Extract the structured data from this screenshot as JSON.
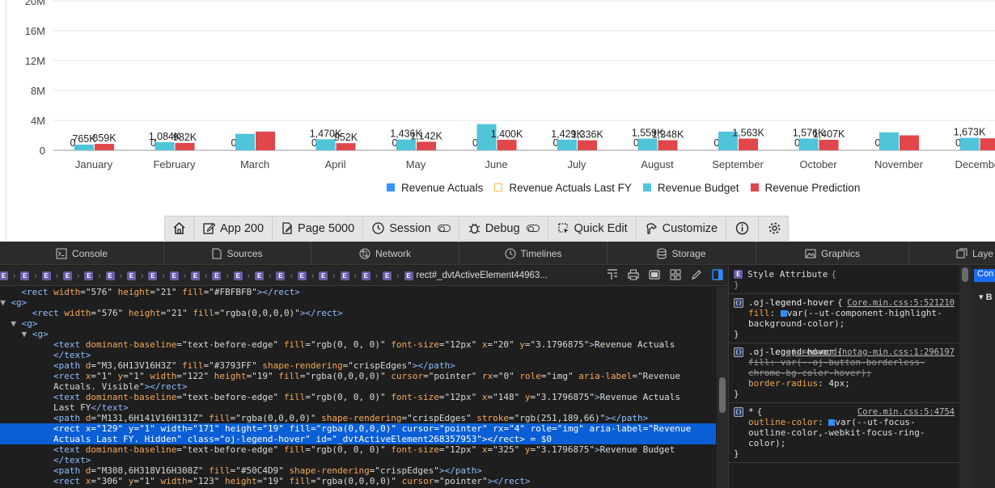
{
  "chart_data": {
    "type": "bar",
    "categories": [
      "January",
      "February",
      "March",
      "April",
      "May",
      "June",
      "July",
      "August",
      "September",
      "October",
      "November",
      "December"
    ],
    "y_ticks": [
      "0",
      "4M",
      "8M",
      "12M",
      "16M",
      "20M"
    ],
    "ylim": [
      0,
      20000000
    ],
    "grid": true,
    "legend_placement": "bottom",
    "series": [
      {
        "name": "Revenue Actuals",
        "color": "#3793FF",
        "values": [
          0,
          0,
          0,
          0,
          0,
          0,
          0,
          0,
          0,
          0,
          0,
          0
        ],
        "labels": [
          "0",
          "0",
          "0",
          "0",
          "0",
          "0",
          "0",
          "0",
          "0",
          "0",
          "0",
          "0"
        ]
      },
      {
        "name": "Revenue Actuals Last FY",
        "color": "#FBBD42",
        "hidden": true,
        "values": []
      },
      {
        "name": "Revenue Budget",
        "color": "#50C4D9",
        "values": [
          765000,
          1084000,
          2200000,
          1470000,
          1436000,
          3500000,
          1429000,
          1559000,
          2500000,
          1576000,
          2400000,
          1673000
        ],
        "labels": [
          "765K",
          "1,084K",
          "",
          "1,470K",
          "1,436K",
          "",
          "1,429K",
          "1,559K",
          "",
          "1,576K",
          "",
          "1,673K"
        ]
      },
      {
        "name": "Revenue Prediction",
        "color": "#E0464A",
        "values": [
          859000,
          982000,
          2500000,
          952000,
          1142000,
          1400000,
          1336000,
          1348000,
          1563000,
          1407000,
          2000000,
          1600000
        ],
        "labels": [
          "859K",
          "982K",
          "",
          "952K",
          "1,142K",
          "1,400K",
          "1,336K",
          "1,348K",
          "1,563K",
          "1,407K",
          "",
          ""
        ]
      }
    ]
  },
  "toolbar": {
    "items": [
      {
        "icon": "home-icon",
        "label": ""
      },
      {
        "icon": "edit-icon",
        "label": "App 200"
      },
      {
        "icon": "page-icon",
        "label": "Page 5000"
      },
      {
        "icon": "session-icon",
        "label": "Session"
      },
      {
        "icon": "debug-icon",
        "label": "Debug"
      },
      {
        "icon": "quick-edit-icon",
        "label": "Quick Edit"
      },
      {
        "icon": "customize-icon",
        "label": "Customize"
      },
      {
        "icon": "info-icon",
        "label": ""
      },
      {
        "icon": "gear-icon",
        "label": ""
      }
    ]
  },
  "devtools": {
    "tabs": [
      {
        "icon": "console-icon",
        "label": "Console"
      },
      {
        "icon": "sources-icon",
        "label": "Sources"
      },
      {
        "icon": "network-icon",
        "label": "Network"
      },
      {
        "icon": "timelines-icon",
        "label": "Timelines"
      },
      {
        "icon": "storage-icon",
        "label": "Storage"
      },
      {
        "icon": "graphics-icon",
        "label": "Graphics"
      },
      {
        "icon": "layers-icon",
        "label": "Laye"
      }
    ],
    "breadcrumb_last": "rect#_dvtActiveElement44963...",
    "styles": {
      "style_attribute": "Style Attribute",
      "rule1_selector": ".oj-legend-hover",
      "rule1_source": "Core.min.css:5:521210",
      "rule1_prop": "fill",
      "rule1_value": "var(--ut-component-highlight-background-color);",
      "rule2_selector": ".oj-legend-hover",
      "rule2_source": "oj-redwood-notag-min.css:1:296197",
      "rule2_prop1": "fill",
      "rule2_value1": "var(--oj-button-borderless-chrome-bg-color-hover);",
      "rule2_prop2": "border-radius",
      "rule2_value2": "4px;",
      "rule3_selector": "*",
      "rule3_source": "Core.min.css:5:4754",
      "rule3_prop": "outline-color",
      "rule3_value": "var(--ut-focus-outline-color,-webkit-focus-ring-color);",
      "computed_label": "Con",
      "computed_b": "B"
    }
  }
}
